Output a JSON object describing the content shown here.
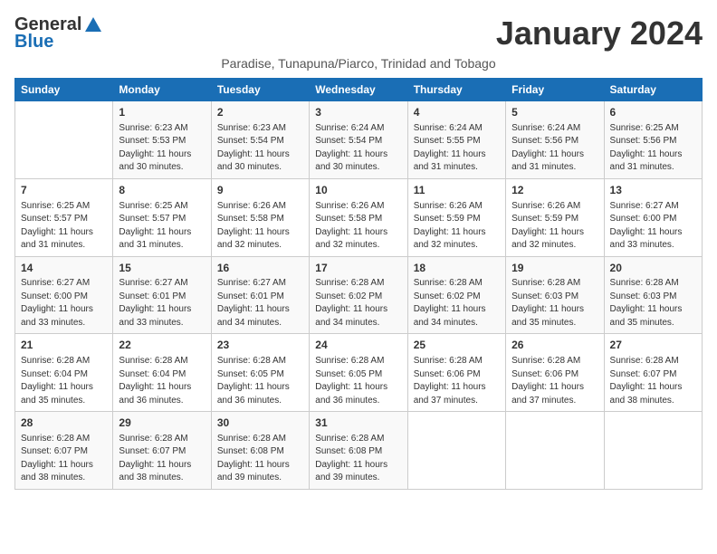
{
  "logo": {
    "general": "General",
    "blue": "Blue"
  },
  "title": "January 2024",
  "subtitle": "Paradise, Tunapuna/Piarco, Trinidad and Tobago",
  "headers": [
    "Sunday",
    "Monday",
    "Tuesday",
    "Wednesday",
    "Thursday",
    "Friday",
    "Saturday"
  ],
  "weeks": [
    [
      {
        "day": "",
        "content": ""
      },
      {
        "day": "1",
        "content": "Sunrise: 6:23 AM\nSunset: 5:53 PM\nDaylight: 11 hours\nand 30 minutes."
      },
      {
        "day": "2",
        "content": "Sunrise: 6:23 AM\nSunset: 5:54 PM\nDaylight: 11 hours\nand 30 minutes."
      },
      {
        "day": "3",
        "content": "Sunrise: 6:24 AM\nSunset: 5:54 PM\nDaylight: 11 hours\nand 30 minutes."
      },
      {
        "day": "4",
        "content": "Sunrise: 6:24 AM\nSunset: 5:55 PM\nDaylight: 11 hours\nand 31 minutes."
      },
      {
        "day": "5",
        "content": "Sunrise: 6:24 AM\nSunset: 5:56 PM\nDaylight: 11 hours\nand 31 minutes."
      },
      {
        "day": "6",
        "content": "Sunrise: 6:25 AM\nSunset: 5:56 PM\nDaylight: 11 hours\nand 31 minutes."
      }
    ],
    [
      {
        "day": "7",
        "content": "Sunrise: 6:25 AM\nSunset: 5:57 PM\nDaylight: 11 hours\nand 31 minutes."
      },
      {
        "day": "8",
        "content": "Sunrise: 6:25 AM\nSunset: 5:57 PM\nDaylight: 11 hours\nand 31 minutes."
      },
      {
        "day": "9",
        "content": "Sunrise: 6:26 AM\nSunset: 5:58 PM\nDaylight: 11 hours\nand 32 minutes."
      },
      {
        "day": "10",
        "content": "Sunrise: 6:26 AM\nSunset: 5:58 PM\nDaylight: 11 hours\nand 32 minutes."
      },
      {
        "day": "11",
        "content": "Sunrise: 6:26 AM\nSunset: 5:59 PM\nDaylight: 11 hours\nand 32 minutes."
      },
      {
        "day": "12",
        "content": "Sunrise: 6:26 AM\nSunset: 5:59 PM\nDaylight: 11 hours\nand 32 minutes."
      },
      {
        "day": "13",
        "content": "Sunrise: 6:27 AM\nSunset: 6:00 PM\nDaylight: 11 hours\nand 33 minutes."
      }
    ],
    [
      {
        "day": "14",
        "content": "Sunrise: 6:27 AM\nSunset: 6:00 PM\nDaylight: 11 hours\nand 33 minutes."
      },
      {
        "day": "15",
        "content": "Sunrise: 6:27 AM\nSunset: 6:01 PM\nDaylight: 11 hours\nand 33 minutes."
      },
      {
        "day": "16",
        "content": "Sunrise: 6:27 AM\nSunset: 6:01 PM\nDaylight: 11 hours\nand 34 minutes."
      },
      {
        "day": "17",
        "content": "Sunrise: 6:28 AM\nSunset: 6:02 PM\nDaylight: 11 hours\nand 34 minutes."
      },
      {
        "day": "18",
        "content": "Sunrise: 6:28 AM\nSunset: 6:02 PM\nDaylight: 11 hours\nand 34 minutes."
      },
      {
        "day": "19",
        "content": "Sunrise: 6:28 AM\nSunset: 6:03 PM\nDaylight: 11 hours\nand 35 minutes."
      },
      {
        "day": "20",
        "content": "Sunrise: 6:28 AM\nSunset: 6:03 PM\nDaylight: 11 hours\nand 35 minutes."
      }
    ],
    [
      {
        "day": "21",
        "content": "Sunrise: 6:28 AM\nSunset: 6:04 PM\nDaylight: 11 hours\nand 35 minutes."
      },
      {
        "day": "22",
        "content": "Sunrise: 6:28 AM\nSunset: 6:04 PM\nDaylight: 11 hours\nand 36 minutes."
      },
      {
        "day": "23",
        "content": "Sunrise: 6:28 AM\nSunset: 6:05 PM\nDaylight: 11 hours\nand 36 minutes."
      },
      {
        "day": "24",
        "content": "Sunrise: 6:28 AM\nSunset: 6:05 PM\nDaylight: 11 hours\nand 36 minutes."
      },
      {
        "day": "25",
        "content": "Sunrise: 6:28 AM\nSunset: 6:06 PM\nDaylight: 11 hours\nand 37 minutes."
      },
      {
        "day": "26",
        "content": "Sunrise: 6:28 AM\nSunset: 6:06 PM\nDaylight: 11 hours\nand 37 minutes."
      },
      {
        "day": "27",
        "content": "Sunrise: 6:28 AM\nSunset: 6:07 PM\nDaylight: 11 hours\nand 38 minutes."
      }
    ],
    [
      {
        "day": "28",
        "content": "Sunrise: 6:28 AM\nSunset: 6:07 PM\nDaylight: 11 hours\nand 38 minutes."
      },
      {
        "day": "29",
        "content": "Sunrise: 6:28 AM\nSunset: 6:07 PM\nDaylight: 11 hours\nand 38 minutes."
      },
      {
        "day": "30",
        "content": "Sunrise: 6:28 AM\nSunset: 6:08 PM\nDaylight: 11 hours\nand 39 minutes."
      },
      {
        "day": "31",
        "content": "Sunrise: 6:28 AM\nSunset: 6:08 PM\nDaylight: 11 hours\nand 39 minutes."
      },
      {
        "day": "",
        "content": ""
      },
      {
        "day": "",
        "content": ""
      },
      {
        "day": "",
        "content": ""
      }
    ]
  ]
}
